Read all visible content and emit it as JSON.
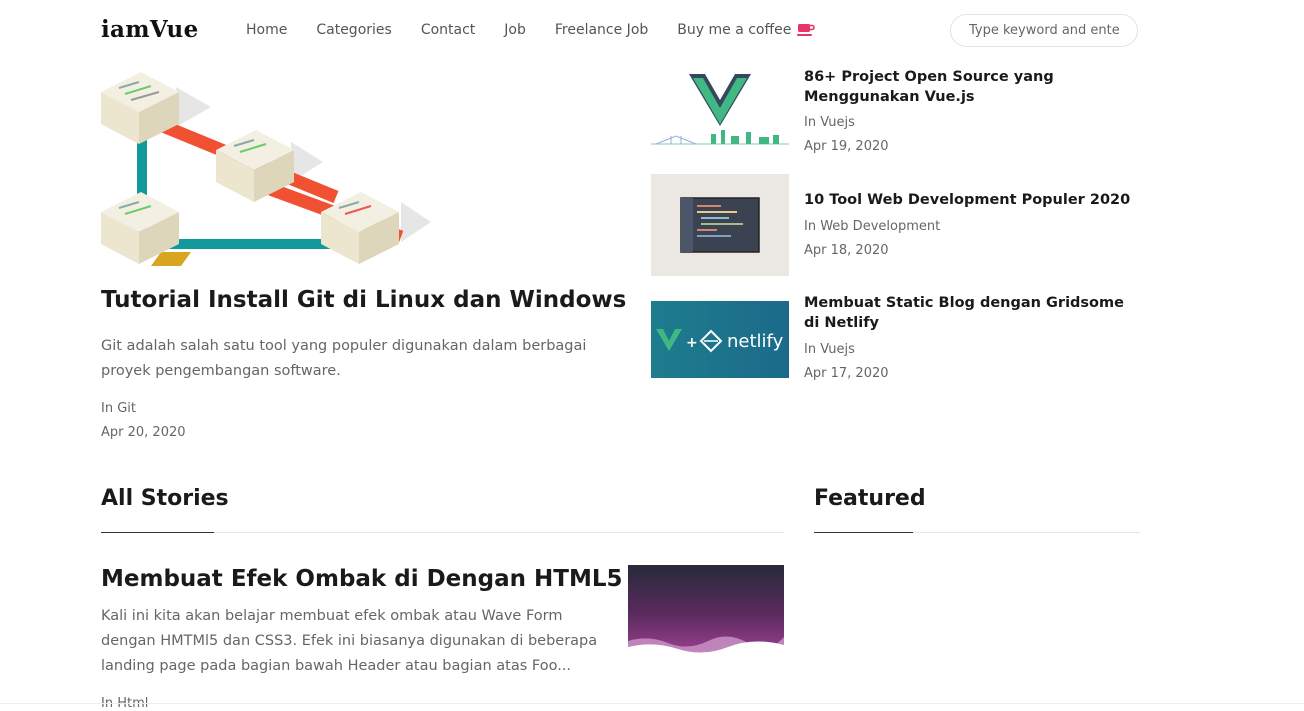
{
  "brand": "iamVue",
  "nav": {
    "home": "Home",
    "categories": "Categories",
    "contact": "Contact",
    "job": "Job",
    "freelance": "Freelance Job",
    "coffee": "Buy me a coffee",
    "coffee_icon": "coffee-cup-icon"
  },
  "search": {
    "placeholder": "Type keyword and enter.."
  },
  "hero": {
    "title": "Tutorial Install Git di Linux dan Windows",
    "description": "Git adalah salah satu tool yang populer digunakan dalam berbagai proyek pengembangan software.",
    "category": "In Git",
    "date": "Apr 20, 2020"
  },
  "side_posts": [
    {
      "title": "86+ Project Open Source yang Menggunakan Vue.js",
      "category": "In Vuejs",
      "date": "Apr 19, 2020"
    },
    {
      "title": "10 Tool Web Development Populer 2020",
      "category": "In Web Development",
      "date": "Apr 18, 2020"
    },
    {
      "title": "Membuat Static Blog dengan Gridsome di Netlify",
      "category": "In Vuejs",
      "date": "Apr 17, 2020",
      "thumb_text": "netlify"
    }
  ],
  "sections": {
    "all_stories": "All Stories",
    "featured": "Featured"
  },
  "story": {
    "title": "Membuat Efek Ombak di Dengan HTML5",
    "description": "Kali ini kita akan belajar membuat efek ombak atau Wave Form dengan HMTMl5 dan CSS3. Efek ini biasanya digunakan di beberapa landing page pada bagian bawah Header atau bagian atas Foo...",
    "category": "In Html"
  },
  "colors": {
    "accent": "#e8336b",
    "vue_green": "#41b883",
    "vue_dark": "#35495e",
    "netlify_bg": "#1f7f90"
  }
}
